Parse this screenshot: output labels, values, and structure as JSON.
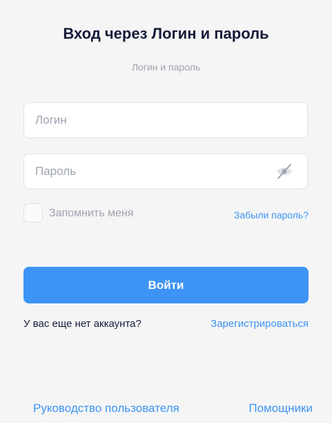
{
  "header": {
    "title": "Вход через Логин и пароль",
    "subtitle": "Логин и пароль"
  },
  "form": {
    "login_placeholder": "Логин",
    "login_value": "",
    "password_placeholder": "Пароль",
    "password_value": "",
    "password_toggle_icon": "eye-crossed-icon",
    "remember_label": "Запомнить меня",
    "remember_checked": false,
    "forgot_link": "Забыли пароль?",
    "submit_label": "Войти"
  },
  "register": {
    "prompt": "У вас еще нет аккаунта?",
    "link": "Зарегистрироваться"
  },
  "footer": {
    "guide_link": "Руководство пользователя",
    "helpers_link": "Помощники"
  },
  "colors": {
    "accent": "#3d94f6",
    "title": "#151c3a",
    "muted": "#9ea3b0",
    "background": "#f5f5f5"
  }
}
